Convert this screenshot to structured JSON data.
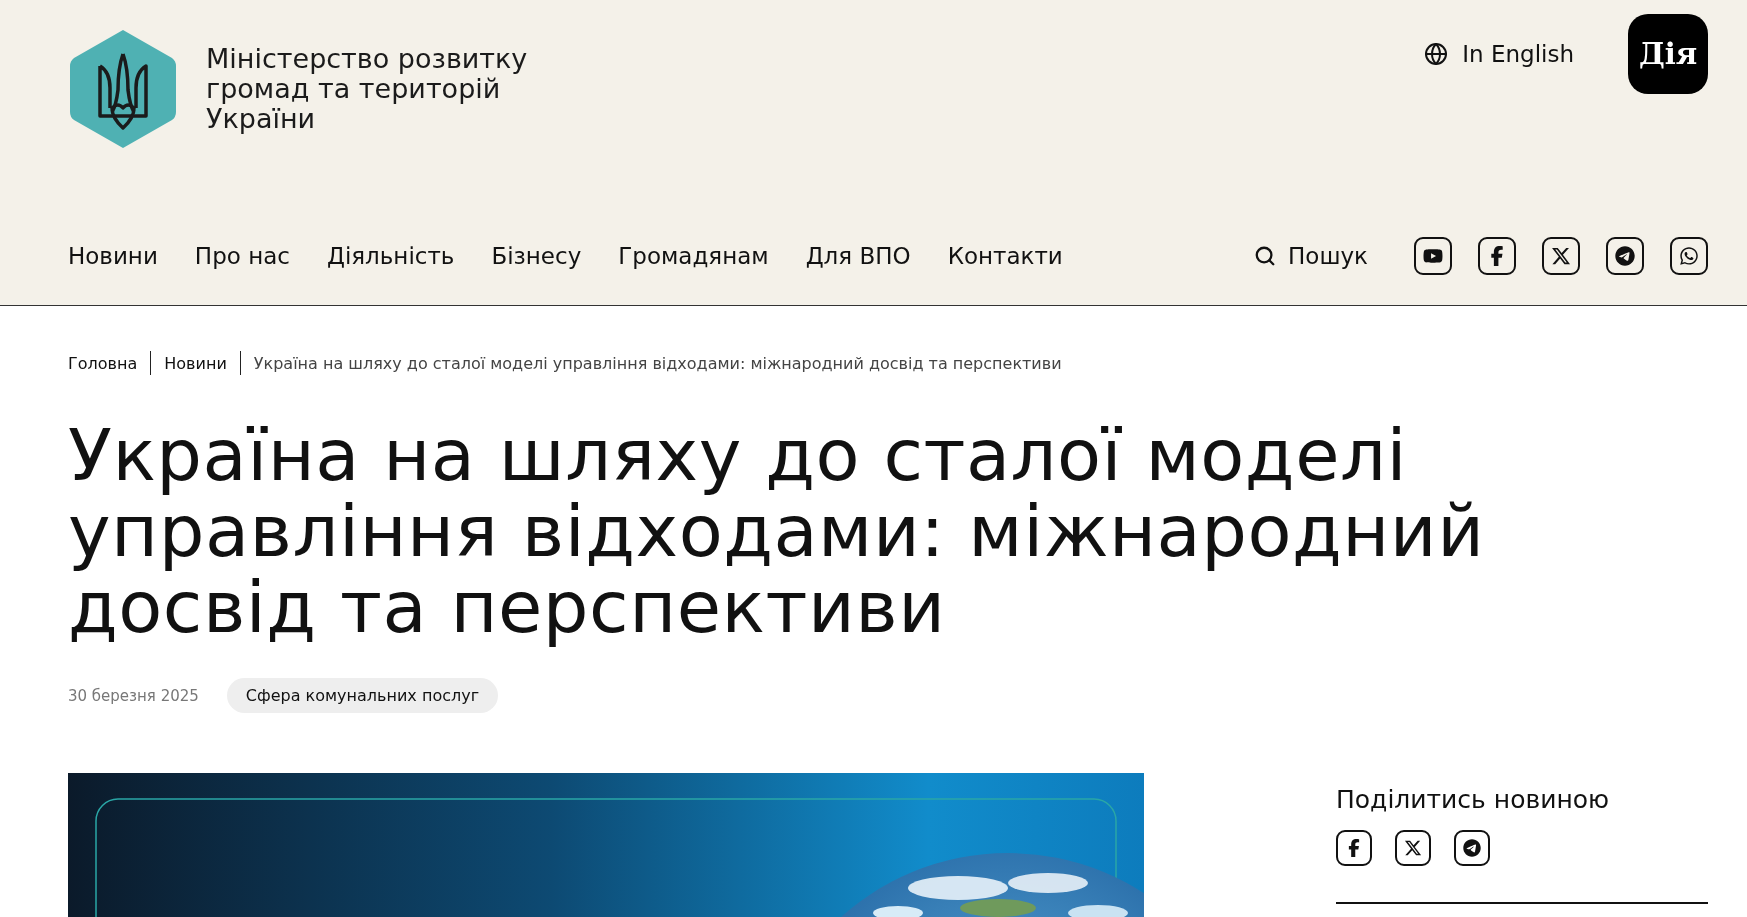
{
  "header": {
    "ministry_name_lines": [
      "Міністерство розвитку",
      "громад та територій",
      "України"
    ],
    "language_link": "In English",
    "app_button": "Дія"
  },
  "nav": {
    "items": [
      {
        "label": "Новини"
      },
      {
        "label": "Про нас"
      },
      {
        "label": "Діяльність"
      },
      {
        "label": "Бізнесу"
      },
      {
        "label": "Громадянам"
      },
      {
        "label": "Для ВПО"
      },
      {
        "label": "Контакти"
      }
    ],
    "search": "Пошук",
    "social_links": [
      {
        "kind": "youtube"
      },
      {
        "kind": "facebook"
      },
      {
        "kind": "x"
      },
      {
        "kind": "telegram"
      },
      {
        "kind": "whatsapp"
      }
    ]
  },
  "breadcrumbs": [
    {
      "label": "Головна",
      "current": false
    },
    {
      "label": "Новини",
      "current": false
    },
    {
      "label": "Україна на шляху до сталої моделі управління відходами: міжнародний досвід та перспективи",
      "current": true
    }
  ],
  "article": {
    "title_lines": [
      "Україна на шляху до сталої моделі",
      "управління відходами: міжнародний",
      "досвід та перспективи"
    ],
    "date": "30 березня 2025",
    "tag": "Сфера комунальних послуг"
  },
  "share": {
    "title": "Поділитись новиною",
    "links": [
      {
        "kind": "facebook"
      },
      {
        "kind": "x"
      },
      {
        "kind": "telegram"
      }
    ]
  }
}
